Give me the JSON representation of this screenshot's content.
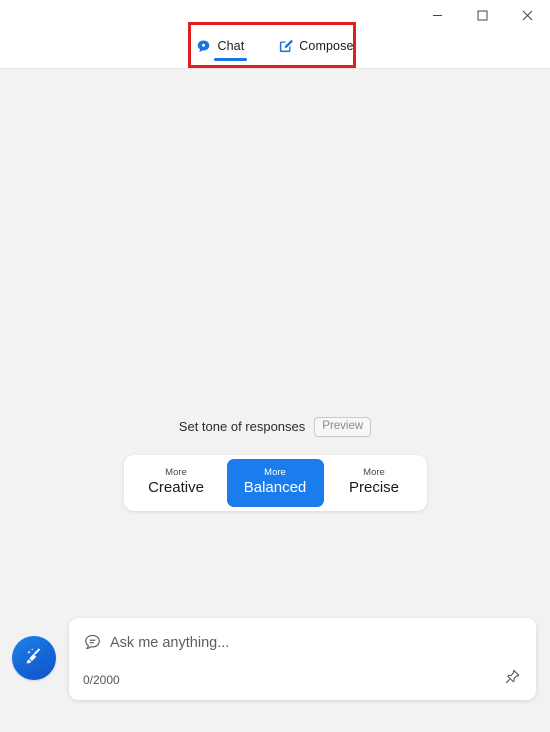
{
  "window": {
    "controls": [
      {
        "name": "minimize",
        "label": "Minimize",
        "glyph": "minimize-icon"
      },
      {
        "name": "maximize",
        "label": "Maximize",
        "glyph": "maximize-icon"
      },
      {
        "name": "close",
        "label": "Close",
        "glyph": "close-icon"
      }
    ]
  },
  "tabs": [
    {
      "label": "Chat",
      "icon": "chat-bubble-icon",
      "active": true
    },
    {
      "label": "Compose",
      "icon": "compose-pencil-icon",
      "active": false
    }
  ],
  "tone": {
    "heading": "Set tone of responses",
    "preview_badge": "Preview",
    "options": [
      {
        "sub": "More",
        "main": "Creative",
        "selected": false
      },
      {
        "sub": "More",
        "main": "Balanced",
        "selected": true
      },
      {
        "sub": "More",
        "main": "Precise",
        "selected": false
      }
    ]
  },
  "composer": {
    "new_topic_icon": "broom-icon",
    "bubble_icon": "chat-message-icon",
    "placeholder": "Ask me anything...",
    "value": "",
    "counter": "0/2000",
    "pin_icon": "pin-icon"
  },
  "colors": {
    "accent_blue": "#1b7ced",
    "tab_underline": "#1b74e4",
    "highlight_red": "#e02020",
    "body_background": "#f2f2f2",
    "surface_white": "#ffffff"
  }
}
